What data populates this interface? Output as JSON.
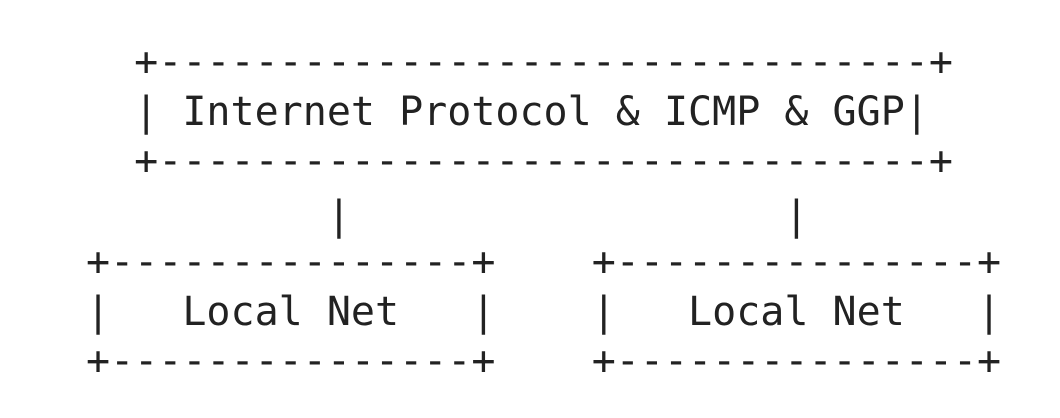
{
  "diagram": {
    "lines": [
      "  +--------------------------------+",
      "  | Internet Protocol & ICMP & GGP|",
      "  +--------------------------------+",
      "          |                  |",
      "+---------------+    +---------------+",
      "|   Local Net   |    |   Local Net   |",
      "+---------------+    +---------------+"
    ],
    "nodes": [
      {
        "label": "Internet Protocol & ICMP & GGP"
      },
      {
        "label": "Local Net"
      },
      {
        "label": "Local Net"
      }
    ]
  }
}
